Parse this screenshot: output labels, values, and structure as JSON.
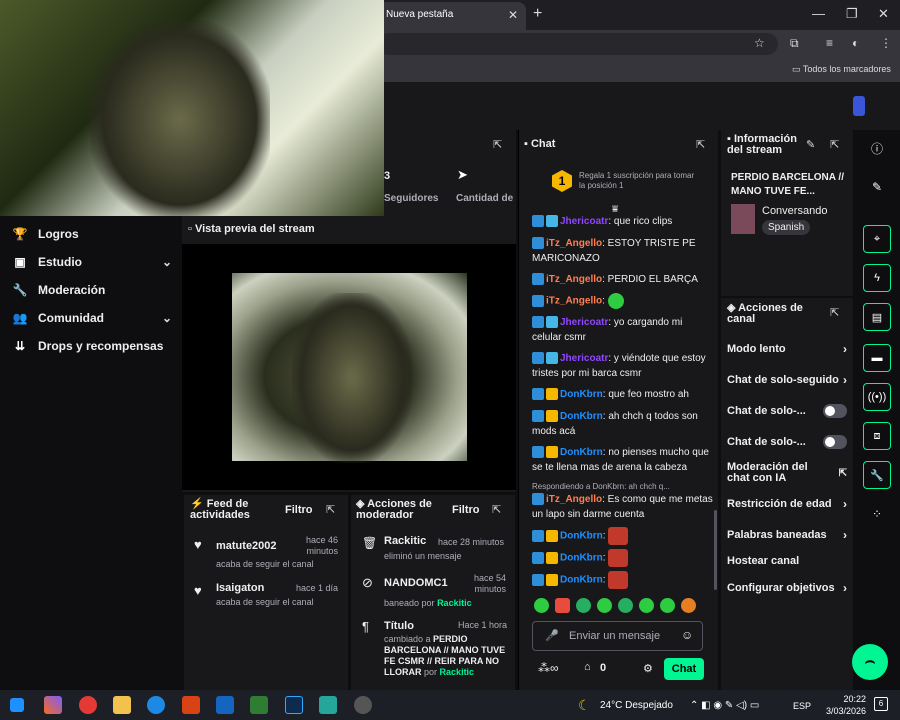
{
  "browser": {
    "tab_title": "Nueva pestaña",
    "tab_close": "✕",
    "new_tab": "+",
    "win_min": "—",
    "win_max": "❐",
    "win_close": "✕",
    "bookmarks_label": "Todos los marcadores"
  },
  "leftnav": {
    "items": [
      {
        "label": "Logros",
        "icon": "trophy-icon"
      },
      {
        "label": "Estudio",
        "icon": "film-icon",
        "expandable": true
      },
      {
        "label": "Moderación",
        "icon": "wrench-icon"
      },
      {
        "label": "Comunidad",
        "icon": "people-icon",
        "expandable": true
      },
      {
        "label": "Drops y recompensas",
        "icon": "gift-icon"
      }
    ]
  },
  "stats": {
    "value_partial": "3",
    "followers_label": "Seguidores",
    "quantity_label": "Cantidad de"
  },
  "preview": {
    "title": "Vista previa del stream"
  },
  "feed": {
    "title": "Feed de actividades",
    "filter": "Filtro",
    "items": [
      {
        "name": "matute2002",
        "sub": "acaba de seguir el canal",
        "time1": "hace 46",
        "time2": "minutos"
      },
      {
        "name": "Isaigaton",
        "sub": "acaba de seguir el canal",
        "time1": "hace 1 día",
        "time2": ""
      }
    ]
  },
  "modactions": {
    "title": "Acciones de moderador",
    "filter": "Filtro",
    "items": [
      {
        "name": "Rackitic",
        "time": "hace 28 minutos",
        "desc": "eliminó un mensaje"
      },
      {
        "name": "NANDOMC1",
        "time1": "hace 54",
        "time2": "minutos",
        "desc_pre": "baneado por",
        "desc_user": "Rackitic"
      },
      {
        "name": "Título",
        "time": "Hace 1 hora",
        "desc_pre": "cambiado a",
        "desc_bold": "PERDIO BARCELONA // MANO TUVE FE CSMR // REIR PARA NO LLORAR",
        "desc_por": "por",
        "desc_user": "Rackitic"
      }
    ]
  },
  "chat": {
    "title": "Chat",
    "gift_text": "Regala 1 suscripción para tomar la posición 1",
    "gift_rank": "1",
    "messages": [
      {
        "user": "Jhericoatr",
        "color": "purple",
        "text": ": que rico clips"
      },
      {
        "user": "iTz_Angello",
        "color": "orange",
        "text": ": ESTOY TRISTE PE MARICONAZO"
      },
      {
        "user": "iTz_Angello",
        "color": "orange",
        "text": ": PERDIO EL BARÇA"
      },
      {
        "user": "iTz_Angello",
        "color": "orange",
        "text": ":"
      },
      {
        "user": "Jhericoatr",
        "color": "purple",
        "text": ": yo cargando mi celular csmr"
      },
      {
        "user": "Jhericoatr",
        "color": "purple",
        "text": ": y viéndote que estoy tristes por mi barca csmr"
      },
      {
        "user": "DonKbrn",
        "color": "blue",
        "text": ": que feo mostro ah"
      },
      {
        "user": "DonKbrn",
        "color": "blue",
        "text": ": ah chch q todos son mods acá"
      },
      {
        "user": "DonKbrn",
        "color": "blue",
        "text": ": no pienses mucho que se te llena mas de arena la cabeza"
      },
      {
        "user": "iTz_Angello",
        "color": "orange",
        "text": ": Es como que me metas un lapo sin darme cuenta"
      },
      {
        "user": "DonKbrn",
        "color": "blue",
        "text": ":"
      },
      {
        "user": "DonKbrn",
        "color": "blue",
        "text": ":"
      },
      {
        "user": "DonKbrn",
        "color": "blue",
        "text": ":"
      }
    ],
    "reply_text": "Respondiendo a DonKbrn: ah chch q...",
    "input_placeholder": "Enviar un mensaje",
    "points": "0",
    "send_label": "Chat"
  },
  "info": {
    "title": "Información del stream",
    "stream_title": "PERDIO BARCELONA // MANO TUVE FE...",
    "category": "Conversando",
    "tag": "Spanish"
  },
  "actions": {
    "title": "Acciones de canal",
    "items": [
      {
        "label": "Modo lento",
        "type": "chevron"
      },
      {
        "label": "Chat de solo-seguido",
        "type": "chevron"
      },
      {
        "label": "Chat de solo-...",
        "type": "toggle"
      },
      {
        "label": "Chat de solo-...",
        "type": "toggle"
      },
      {
        "label": "Moderación del chat con IA",
        "type": "external"
      },
      {
        "label": "Restricción de edad",
        "type": "chevron"
      },
      {
        "label": "Palabras baneadas",
        "type": "chevron"
      },
      {
        "label": "Hostear canal",
        "type": "none"
      },
      {
        "label": "Configurar objetivos",
        "type": "chevron"
      }
    ]
  },
  "taskbar": {
    "weather": "24°C  Despejado",
    "lang": "ESP",
    "time": "20:22",
    "date": "3/03/2026",
    "notif": "6"
  },
  "colors": {
    "accent": "#00f593",
    "purple": "#9146ff",
    "orange": "#ff7f50",
    "blue": "#1e90ff"
  }
}
